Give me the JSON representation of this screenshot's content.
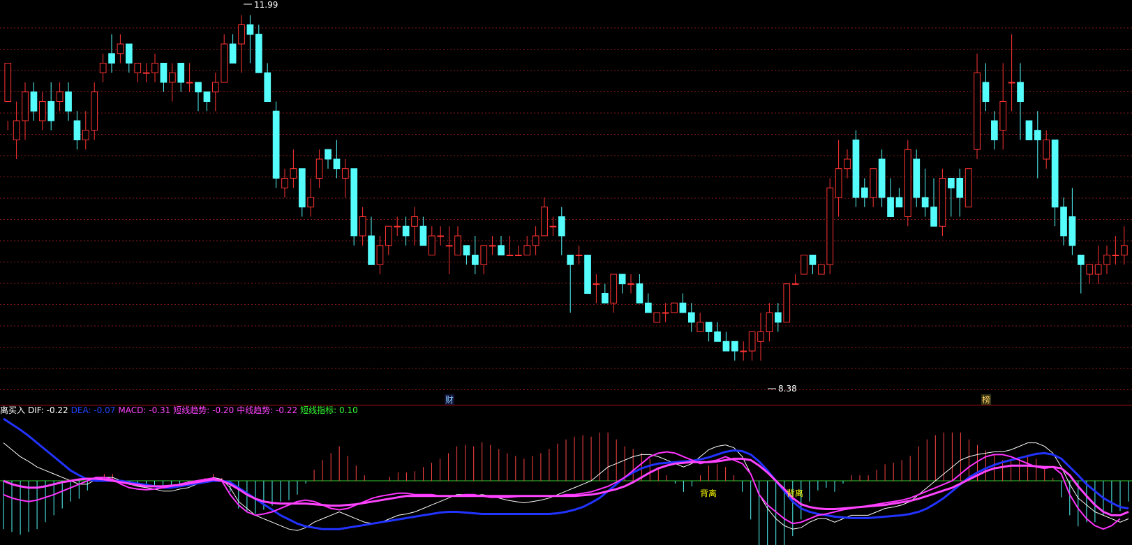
{
  "chart_data": {
    "type": "candlestick",
    "annotations": {
      "high_label": "11.99",
      "low_label": "8.38",
      "marker_1": "财",
      "marker_2": "榜",
      "divergence_1": "背离",
      "divergence_2": "背离"
    },
    "price_ylim": [
      8.2,
      12.2
    ],
    "candles": [
      [
        11.2,
        11.6,
        11.0,
        10.9
      ],
      [
        10.8,
        11.0,
        10.6,
        11.2
      ],
      [
        11.0,
        11.3,
        10.8,
        11.4
      ],
      [
        11.3,
        11.1,
        11.0,
        11.4
      ],
      [
        11.0,
        11.2,
        10.9,
        11.3
      ],
      [
        11.2,
        11.0,
        10.9,
        11.4
      ],
      [
        11.2,
        11.3,
        11.1,
        11.4
      ],
      [
        11.3,
        11.1,
        11.0,
        11.4
      ],
      [
        11.0,
        10.8,
        10.7,
        11.1
      ],
      [
        10.8,
        10.9,
        10.7,
        11.1
      ],
      [
        10.9,
        11.3,
        10.8,
        11.4
      ],
      [
        11.5,
        11.6,
        11.4,
        11.7
      ],
      [
        11.7,
        11.6,
        11.5,
        11.9
      ],
      [
        11.7,
        11.8,
        11.6,
        11.9
      ],
      [
        11.8,
        11.6,
        11.5,
        11.8
      ],
      [
        11.5,
        11.6,
        11.4,
        11.6
      ],
      [
        11.5,
        11.5,
        11.4,
        11.6
      ],
      [
        11.5,
        11.6,
        11.4,
        11.7
      ],
      [
        11.6,
        11.4,
        11.3,
        11.6
      ],
      [
        11.4,
        11.5,
        11.2,
        11.6
      ],
      [
        11.6,
        11.4,
        11.3,
        11.6
      ],
      [
        11.4,
        11.4,
        11.3,
        11.6
      ],
      [
        11.4,
        11.3,
        11.1,
        11.4
      ],
      [
        11.3,
        11.2,
        11.1,
        11.3
      ],
      [
        11.3,
        11.4,
        11.1,
        11.5
      ],
      [
        11.4,
        11.8,
        11.4,
        11.9
      ],
      [
        11.8,
        11.6,
        11.6,
        11.9
      ],
      [
        11.8,
        12.0,
        11.5,
        12.1
      ],
      [
        12.0,
        11.9,
        11.6,
        12.1
      ],
      [
        11.9,
        11.5,
        11.5,
        12.0
      ],
      [
        11.5,
        11.2,
        11.2,
        11.6
      ],
      [
        11.1,
        10.4,
        10.3,
        11.2
      ],
      [
        10.3,
        10.4,
        10.2,
        10.5
      ],
      [
        10.4,
        10.5,
        10.3,
        10.7
      ],
      [
        10.5,
        10.1,
        10.0,
        10.5
      ],
      [
        10.1,
        10.2,
        10.0,
        10.4
      ],
      [
        10.4,
        10.6,
        10.3,
        10.7
      ],
      [
        10.7,
        10.6,
        10.5,
        10.7
      ],
      [
        10.6,
        10.5,
        10.4,
        10.8
      ],
      [
        10.4,
        10.5,
        10.2,
        10.6
      ],
      [
        10.5,
        9.8,
        9.7,
        10.5
      ],
      [
        9.8,
        10.0,
        9.7,
        10.1
      ],
      [
        9.8,
        9.5,
        9.5,
        10.0
      ],
      [
        9.5,
        9.7,
        9.4,
        9.8
      ],
      [
        9.7,
        9.9,
        9.6,
        9.9
      ],
      [
        9.9,
        9.9,
        9.8,
        10.0
      ],
      [
        9.9,
        9.8,
        9.7,
        10.0
      ],
      [
        9.9,
        10.0,
        9.7,
        10.1
      ],
      [
        9.9,
        9.7,
        9.7,
        10.0
      ],
      [
        9.6,
        9.8,
        9.6,
        9.9
      ],
      [
        9.8,
        9.8,
        9.7,
        9.9
      ],
      [
        9.7,
        9.7,
        9.4,
        9.9
      ],
      [
        9.6,
        9.8,
        9.6,
        9.9
      ],
      [
        9.7,
        9.6,
        9.5,
        9.7
      ],
      [
        9.6,
        9.5,
        9.4,
        9.8
      ],
      [
        9.5,
        9.7,
        9.4,
        9.7
      ],
      [
        9.7,
        9.7,
        9.6,
        9.8
      ],
      [
        9.7,
        9.6,
        9.6,
        9.8
      ],
      [
        9.6,
        9.6,
        9.6,
        9.8
      ],
      [
        9.6,
        9.6,
        9.6,
        9.7
      ],
      [
        9.6,
        9.7,
        9.6,
        9.8
      ],
      [
        9.7,
        9.8,
        9.6,
        9.9
      ],
      [
        9.8,
        10.1,
        9.8,
        10.2
      ],
      [
        9.9,
        9.9,
        9.8,
        10.0
      ],
      [
        10.0,
        9.8,
        9.6,
        10.1
      ],
      [
        9.6,
        9.5,
        9.0,
        9.6
      ],
      [
        9.6,
        9.6,
        9.5,
        9.7
      ],
      [
        9.6,
        9.2,
        9.2,
        9.6
      ],
      [
        9.3,
        9.3,
        9.1,
        9.4
      ],
      [
        9.2,
        9.1,
        9.1,
        9.3
      ],
      [
        9.1,
        9.4,
        9.0,
        9.4
      ],
      [
        9.4,
        9.3,
        9.2,
        9.4
      ],
      [
        9.3,
        9.3,
        9.2,
        9.4
      ],
      [
        9.3,
        9.1,
        9.1,
        9.4
      ],
      [
        9.1,
        9.0,
        9.0,
        9.2
      ],
      [
        8.9,
        9.0,
        8.9,
        9.0
      ],
      [
        9.0,
        9.0,
        8.9,
        9.1
      ],
      [
        9.0,
        9.1,
        9.0,
        9.1
      ],
      [
        9.1,
        9.0,
        9.0,
        9.2
      ],
      [
        9.0,
        8.9,
        8.8,
        9.1
      ],
      [
        8.8,
        8.9,
        8.8,
        9.0
      ],
      [
        8.9,
        8.8,
        8.7,
        8.9
      ],
      [
        8.8,
        8.7,
        8.7,
        8.9
      ],
      [
        8.7,
        8.6,
        8.6,
        8.8
      ],
      [
        8.7,
        8.6,
        8.5,
        8.7
      ],
      [
        8.6,
        8.6,
        8.5,
        8.7
      ],
      [
        8.6,
        8.8,
        8.5,
        8.8
      ],
      [
        8.7,
        8.8,
        8.5,
        9.0
      ],
      [
        8.8,
        9.0,
        8.7,
        9.1
      ],
      [
        9.0,
        8.9,
        8.8,
        9.1
      ],
      [
        8.9,
        9.3,
        8.9,
        9.3
      ],
      [
        9.3,
        9.3,
        9.3,
        9.4
      ],
      [
        9.4,
        9.6,
        9.4,
        9.6
      ],
      [
        9.6,
        9.5,
        9.4,
        9.6
      ],
      [
        9.4,
        9.5,
        9.4,
        9.5
      ],
      [
        9.5,
        10.3,
        9.4,
        10.4
      ],
      [
        10.2,
        10.5,
        10.0,
        10.8
      ],
      [
        10.5,
        10.6,
        10.4,
        10.7
      ],
      [
        10.8,
        10.2,
        10.1,
        10.9
      ],
      [
        10.3,
        10.2,
        10.1,
        10.4
      ],
      [
        10.2,
        10.5,
        10.1,
        10.5
      ],
      [
        10.6,
        10.2,
        10.1,
        10.7
      ],
      [
        10.2,
        10.0,
        10.0,
        10.4
      ],
      [
        10.2,
        10.1,
        10.1,
        10.3
      ],
      [
        10.0,
        10.7,
        9.9,
        10.8
      ],
      [
        10.6,
        10.2,
        10.1,
        10.7
      ],
      [
        10.2,
        10.1,
        10.0,
        10.5
      ],
      [
        10.1,
        9.9,
        9.9,
        10.4
      ],
      [
        9.9,
        10.4,
        9.8,
        10.5
      ],
      [
        10.4,
        10.3,
        10.0,
        10.4
      ],
      [
        10.4,
        10.2,
        10.0,
        10.5
      ],
      [
        10.1,
        10.5,
        10.1,
        10.5
      ],
      [
        10.7,
        11.5,
        10.6,
        11.7
      ],
      [
        11.4,
        11.2,
        11.1,
        11.6
      ],
      [
        11.0,
        10.8,
        10.7,
        11.1
      ],
      [
        10.9,
        11.2,
        10.7,
        11.6
      ],
      [
        11.4,
        11.4,
        11.1,
        11.9
      ],
      [
        11.4,
        11.2,
        10.8,
        11.6
      ],
      [
        11.0,
        10.8,
        10.8,
        11.0
      ],
      [
        10.9,
        10.8,
        10.4,
        11.1
      ],
      [
        10.6,
        10.8,
        10.5,
        10.9
      ],
      [
        10.8,
        10.1,
        9.9,
        10.8
      ],
      [
        10.1,
        9.8,
        9.7,
        10.2
      ],
      [
        10.0,
        9.7,
        9.6,
        10.3
      ],
      [
        9.6,
        9.5,
        9.2,
        9.6
      ],
      [
        9.4,
        9.5,
        9.3,
        9.5
      ],
      [
        9.4,
        9.5,
        9.3,
        9.7
      ],
      [
        9.5,
        9.6,
        9.4,
        9.7
      ],
      [
        9.6,
        9.6,
        9.5,
        9.8
      ],
      [
        9.6,
        9.7,
        9.5,
        9.9
      ]
    ],
    "indicator_labels": [
      {
        "text": "离买入",
        "color": "#ffffff"
      },
      {
        "text": "DIF: -0.22",
        "color": "#ffffff"
      },
      {
        "text": "DEA: -0.07",
        "color": "#2244ff"
      },
      {
        "text": "MACD: -0.31",
        "color": "#ff44ff"
      },
      {
        "text": "短线趋势: -0.20",
        "color": "#ff44ff"
      },
      {
        "text": "中线趋势: -0.22",
        "color": "#ff44ff"
      },
      {
        "text": "短线指标: 0.10",
        "color": "#33ff33"
      }
    ],
    "indicator_ylim": [
      -0.9,
      0.9
    ],
    "dif": [
      0.55,
      0.45,
      0.35,
      0.28,
      0.2,
      0.15,
      0.1,
      0.05,
      0.0,
      -0.05,
      -0.05,
      0.02,
      0.05,
      0.05,
      0.0,
      -0.05,
      -0.08,
      -0.1,
      -0.12,
      -0.15,
      -0.15,
      -0.12,
      -0.1,
      -0.05,
      0.0,
      0.05,
      0.02,
      -0.1,
      -0.3,
      -0.4,
      -0.5,
      -0.55,
      -0.6,
      -0.65,
      -0.7,
      -0.72,
      -0.68,
      -0.6,
      -0.55,
      -0.5,
      -0.45,
      -0.5,
      -0.55,
      -0.6,
      -0.62,
      -0.6,
      -0.55,
      -0.5,
      -0.48,
      -0.45,
      -0.4,
      -0.35,
      -0.3,
      -0.25,
      -0.2,
      -0.2,
      -0.22,
      -0.2,
      -0.22,
      -0.25,
      -0.28,
      -0.3,
      -0.32,
      -0.3,
      -0.28,
      -0.25,
      -0.2,
      -0.15,
      -0.1,
      -0.05,
      0.0,
      0.1,
      0.2,
      0.25,
      0.3,
      0.35,
      0.38,
      0.38,
      0.35,
      0.3,
      0.25,
      0.2,
      0.25,
      0.35,
      0.45,
      0.5,
      0.52,
      0.48,
      0.35,
      0.1,
      -0.2,
      -0.4,
      -0.55,
      -0.65,
      -0.7,
      -0.68,
      -0.6,
      -0.55,
      -0.55,
      -0.6,
      -0.55,
      -0.5,
      -0.5,
      -0.5,
      -0.45,
      -0.4,
      -0.38,
      -0.35,
      -0.3,
      -0.2,
      -0.1,
      0.0,
      0.1,
      0.2,
      0.3,
      0.35,
      0.38,
      0.4,
      0.42,
      0.42,
      0.45,
      0.5,
      0.55,
      0.55,
      0.5,
      0.4,
      0.2,
      -0.05,
      -0.25,
      -0.35,
      -0.45,
      -0.5,
      -0.55,
      -0.6,
      -0.55
    ],
    "dea": [
      0.9,
      0.82,
      0.74,
      0.65,
      0.55,
      0.45,
      0.35,
      0.25,
      0.15,
      0.08,
      0.02,
      0.0,
      0.0,
      0.0,
      0.0,
      -0.02,
      -0.04,
      -0.06,
      -0.08,
      -0.1,
      -0.1,
      -0.08,
      -0.06,
      -0.04,
      -0.02,
      0.0,
      0.0,
      -0.02,
      -0.1,
      -0.18,
      -0.26,
      -0.34,
      -0.42,
      -0.5,
      -0.56,
      -0.62,
      -0.66,
      -0.68,
      -0.7,
      -0.7,
      -0.7,
      -0.68,
      -0.66,
      -0.64,
      -0.62,
      -0.6,
      -0.58,
      -0.56,
      -0.54,
      -0.52,
      -0.5,
      -0.48,
      -0.46,
      -0.45,
      -0.45,
      -0.46,
      -0.47,
      -0.48,
      -0.48,
      -0.48,
      -0.48,
      -0.48,
      -0.48,
      -0.48,
      -0.48,
      -0.48,
      -0.47,
      -0.45,
      -0.42,
      -0.38,
      -0.32,
      -0.25,
      -0.15,
      -0.05,
      0.05,
      0.12,
      0.18,
      0.22,
      0.25,
      0.26,
      0.27,
      0.28,
      0.29,
      0.31,
      0.34,
      0.38,
      0.42,
      0.44,
      0.43,
      0.38,
      0.28,
      0.15,
      0.0,
      -0.15,
      -0.3,
      -0.4,
      -0.45,
      -0.48,
      -0.5,
      -0.52,
      -0.53,
      -0.54,
      -0.54,
      -0.54,
      -0.53,
      -0.52,
      -0.51,
      -0.5,
      -0.48,
      -0.45,
      -0.4,
      -0.33,
      -0.25,
      -0.15,
      -0.05,
      0.05,
      0.12,
      0.18,
      0.23,
      0.27,
      0.3,
      0.33,
      0.36,
      0.39,
      0.4,
      0.38,
      0.32,
      0.2,
      0.08,
      -0.05,
      -0.15,
      -0.25,
      -0.32,
      -0.38,
      -0.4
    ],
    "short_trend": [
      -0.2,
      -0.25,
      -0.28,
      -0.3,
      -0.28,
      -0.24,
      -0.2,
      -0.15,
      -0.1,
      -0.05,
      0.0,
      0.05,
      0.05,
      0.02,
      -0.05,
      -0.1,
      -0.12,
      -0.13,
      -0.12,
      -0.1,
      -0.08,
      -0.05,
      -0.02,
      0.0,
      0.02,
      0.04,
      0.0,
      -0.2,
      -0.35,
      -0.45,
      -0.5,
      -0.48,
      -0.45,
      -0.4,
      -0.35,
      -0.3,
      -0.28,
      -0.3,
      -0.35,
      -0.4,
      -0.42,
      -0.4,
      -0.35,
      -0.3,
      -0.25,
      -0.22,
      -0.2,
      -0.18,
      -0.18,
      -0.2,
      -0.2,
      -0.2,
      -0.22,
      -0.22,
      -0.22,
      -0.2,
      -0.2,
      -0.22,
      -0.24,
      -0.24,
      -0.24,
      -0.23,
      -0.22,
      -0.22,
      -0.22,
      -0.22,
      -0.22,
      -0.2,
      -0.2,
      -0.18,
      -0.16,
      -0.12,
      -0.08,
      -0.02,
      0.05,
      0.15,
      0.25,
      0.35,
      0.4,
      0.42,
      0.4,
      0.35,
      0.3,
      0.25,
      0.28,
      0.3,
      0.35,
      0.3,
      0.25,
      0.1,
      -0.2,
      -0.35,
      -0.45,
      -0.55,
      -0.62,
      -0.6,
      -0.55,
      -0.5,
      -0.48,
      -0.45,
      -0.42,
      -0.4,
      -0.38,
      -0.36,
      -0.34,
      -0.32,
      -0.3,
      -0.28,
      -0.25,
      -0.2,
      -0.15,
      -0.1,
      -0.05,
      0.0,
      0.1,
      0.2,
      0.28,
      0.35,
      0.38,
      0.38,
      0.35,
      0.3,
      0.25,
      0.2,
      0.18,
      0.2,
      0.1,
      -0.2,
      -0.4,
      -0.55,
      -0.65,
      -0.7,
      -0.65,
      -0.55
    ],
    "mid_trend": [
      0.0,
      -0.05,
      -0.08,
      -0.1,
      -0.1,
      -0.08,
      -0.05,
      -0.02,
      0.0,
      0.02,
      0.03,
      0.03,
      0.02,
      0.0,
      -0.02,
      -0.04,
      -0.06,
      -0.08,
      -0.08,
      -0.08,
      -0.07,
      -0.06,
      -0.04,
      -0.02,
      0.0,
      0.02,
      0.0,
      -0.05,
      -0.12,
      -0.2,
      -0.26,
      -0.3,
      -0.32,
      -0.33,
      -0.33,
      -0.33,
      -0.33,
      -0.34,
      -0.35,
      -0.36,
      -0.36,
      -0.35,
      -0.34,
      -0.32,
      -0.3,
      -0.28,
      -0.26,
      -0.24,
      -0.22,
      -0.22,
      -0.22,
      -0.22,
      -0.22,
      -0.22,
      -0.22,
      -0.22,
      -0.22,
      -0.22,
      -0.22,
      -0.22,
      -0.22,
      -0.22,
      -0.22,
      -0.22,
      -0.22,
      -0.22,
      -0.22,
      -0.22,
      -0.22,
      -0.21,
      -0.2,
      -0.18,
      -0.15,
      -0.12,
      -0.08,
      -0.02,
      0.05,
      0.12,
      0.18,
      0.22,
      0.25,
      0.26,
      0.27,
      0.27,
      0.27,
      0.28,
      0.3,
      0.32,
      0.32,
      0.3,
      0.22,
      0.12,
      0.0,
      -0.12,
      -0.25,
      -0.34,
      -0.38,
      -0.4,
      -0.41,
      -0.41,
      -0.4,
      -0.39,
      -0.38,
      -0.37,
      -0.36,
      -0.35,
      -0.33,
      -0.31,
      -0.29,
      -0.26,
      -0.22,
      -0.18,
      -0.14,
      -0.1,
      -0.04,
      0.02,
      0.08,
      0.14,
      0.18,
      0.2,
      0.22,
      0.22,
      0.22,
      0.21,
      0.2,
      0.2,
      0.18,
      0.08,
      -0.08,
      -0.22,
      -0.35,
      -0.45,
      -0.5,
      -0.5,
      -0.45
    ]
  }
}
